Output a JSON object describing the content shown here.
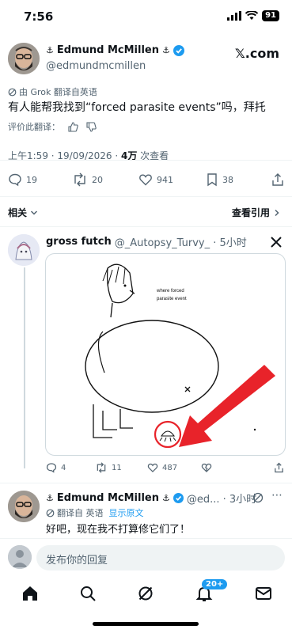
{
  "status_bar": {
    "time": "7:56",
    "battery": "91"
  },
  "main_tweet": {
    "author_name": "Edmund McMillen",
    "handle": "@edmundmcmillen",
    "site_logo": "𝕏.com",
    "translated_note": "由 Grok 翻译自英语",
    "text": "有人能帮我找到“forced parasite events”吗，拜托",
    "rate_translation": "评价此翻译：",
    "meta_time": "上午1:59 · 19/09/2026 · ",
    "views_count": "4万",
    "views_label": " 次查看",
    "replies": "19",
    "reposts": "20",
    "likes": "941",
    "bookmarks": "38"
  },
  "tabs": {
    "related": "相关",
    "quotes": "查看引用"
  },
  "reply1": {
    "name": "gross futch",
    "meta": "@_Autopsy_Turvy_ · 5小时",
    "image_caption_line1": "where forced",
    "image_caption_line2": "parasite event",
    "replies": "4",
    "reposts": "11",
    "likes": "487"
  },
  "reply2": {
    "name": "Edmund McMillen",
    "meta": "@ed... · 3小时",
    "translated_note": "翻译自 英语",
    "show_original": "显示原文",
    "text": "好吧，现在我不打算修它们了！"
  },
  "reply_box": {
    "placeholder": "发布你的回复"
  },
  "nav": {
    "notifications_badge": "20+"
  },
  "colors": {
    "accent": "#1d9bf0",
    "verified": "#1d9bf0",
    "arrow": "#e8232a"
  }
}
